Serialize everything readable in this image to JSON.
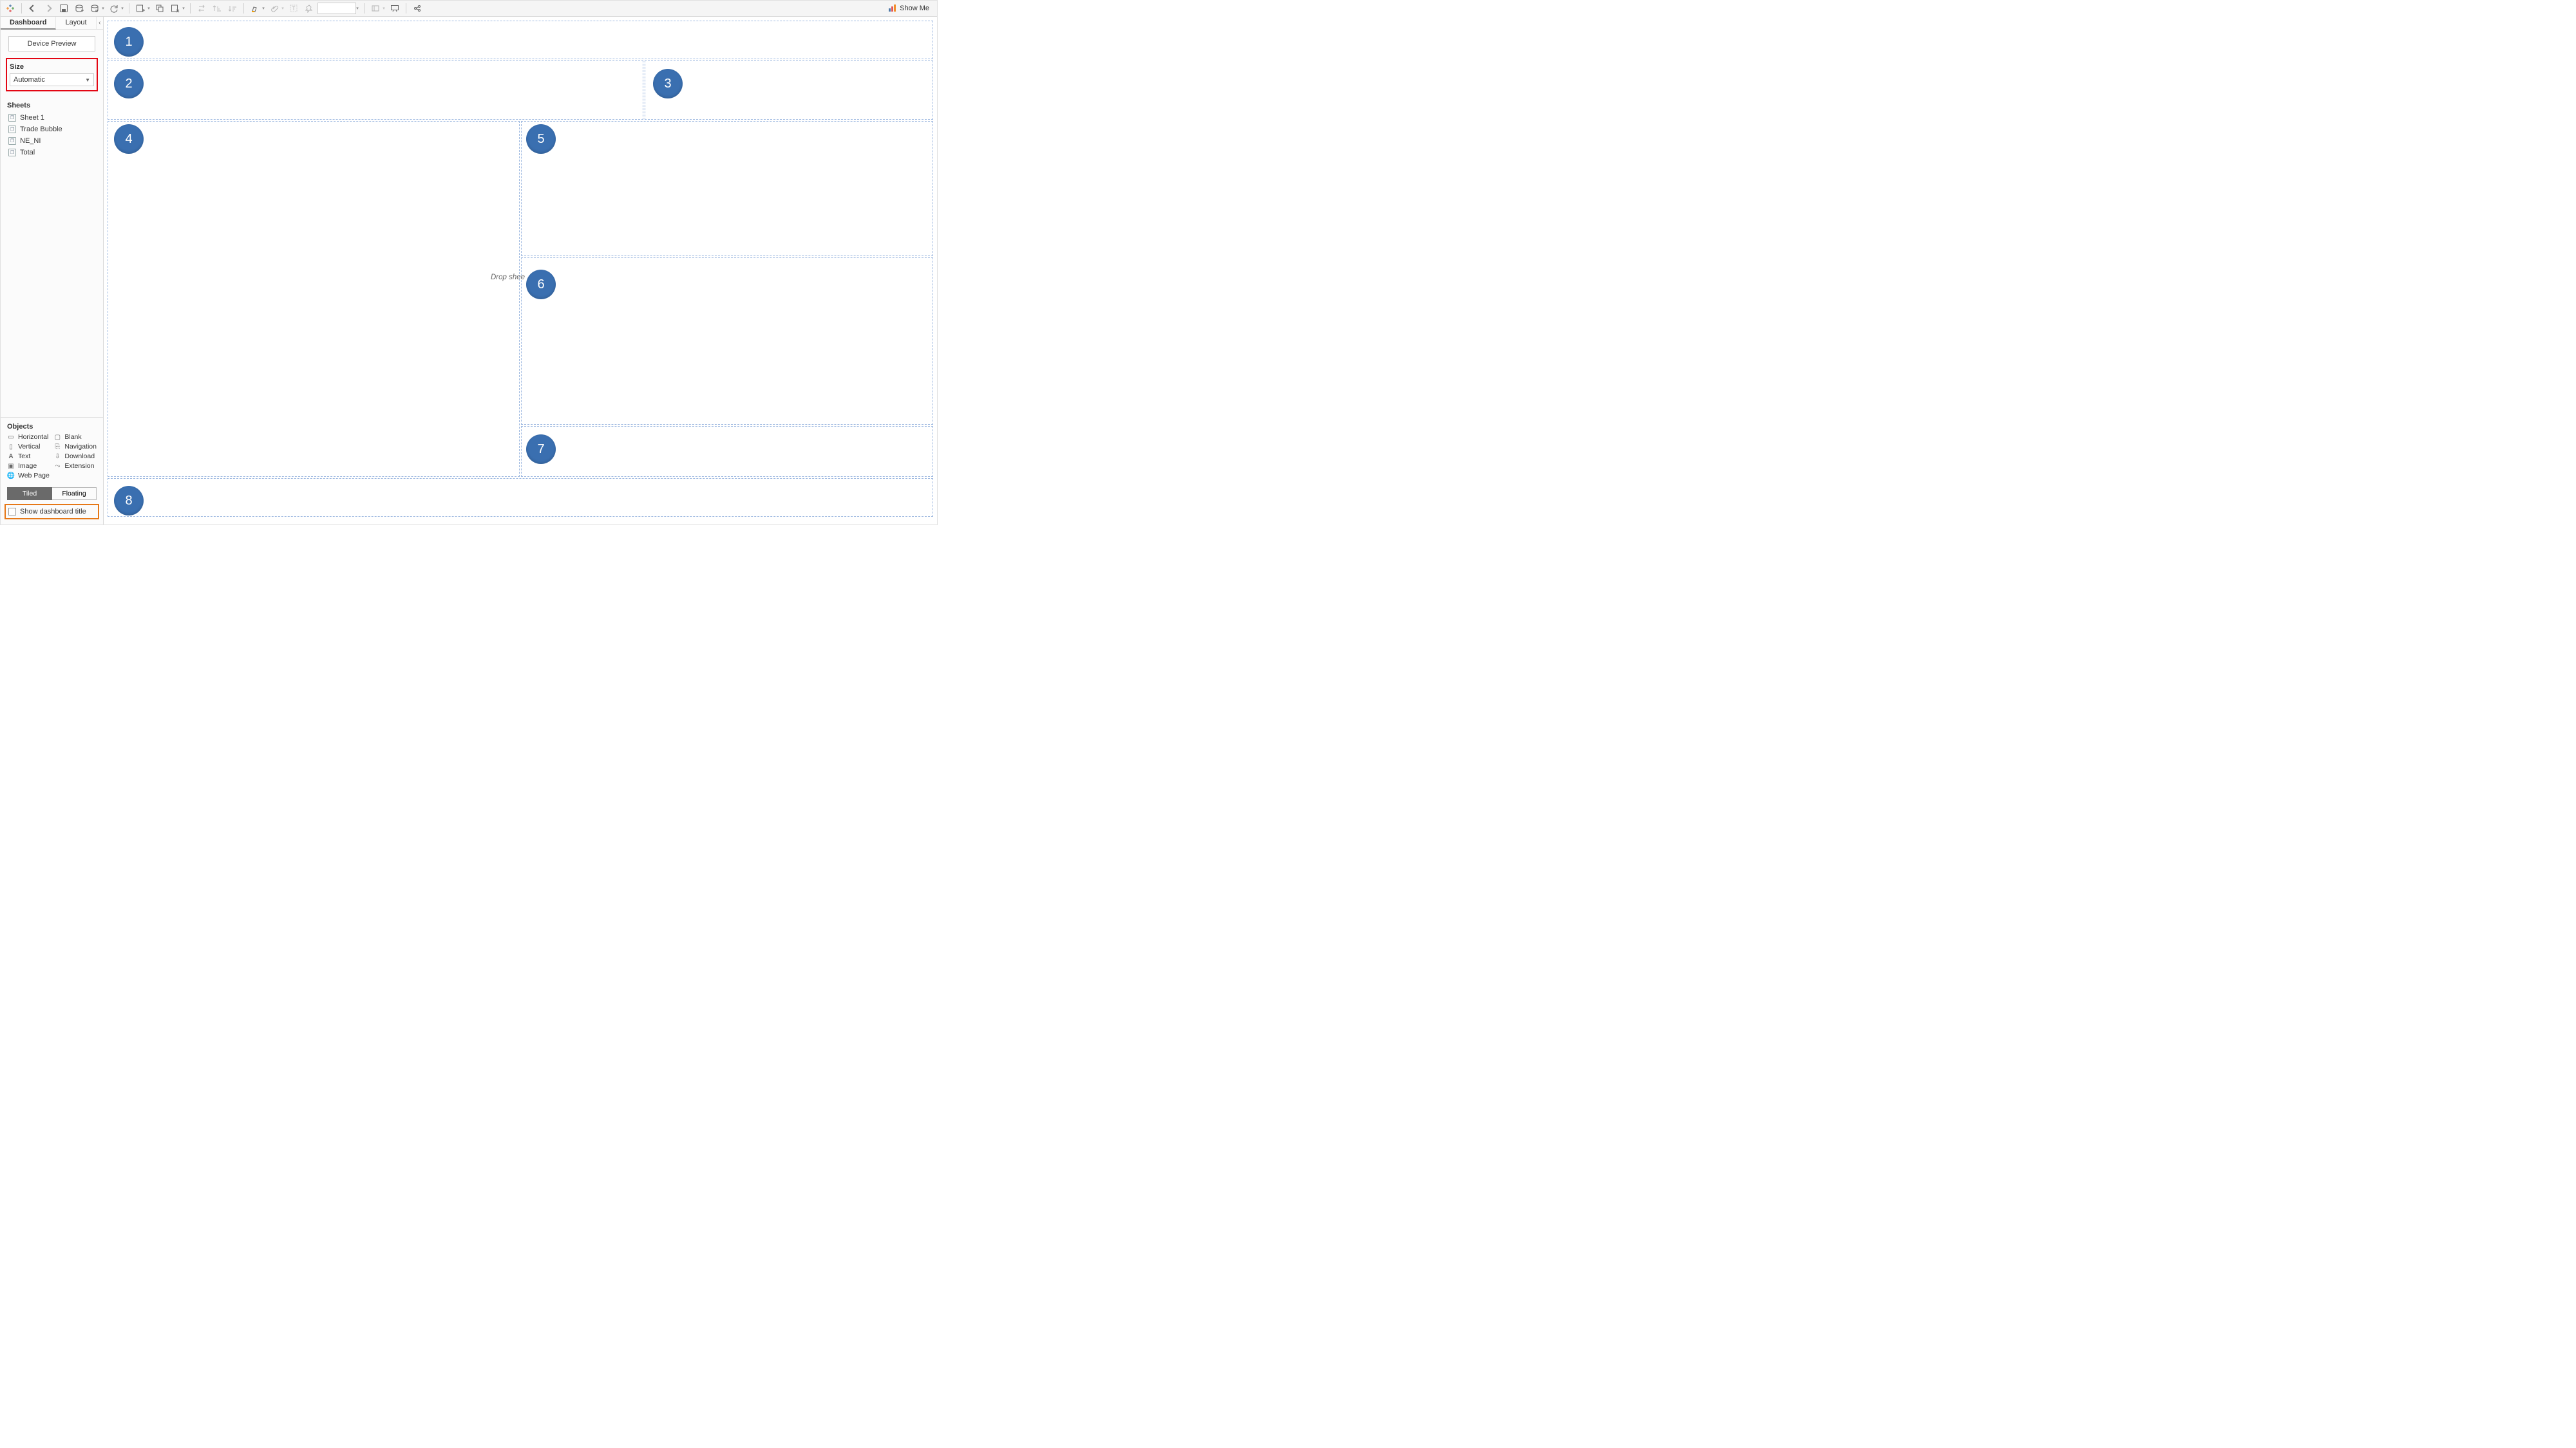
{
  "toolbar": {
    "show_me": "Show Me"
  },
  "sidebar": {
    "tabs": {
      "dashboard": "Dashboard",
      "layout": "Layout"
    },
    "device_preview": "Device Preview",
    "size_label": "Size",
    "size_value": "Automatic",
    "sheets_label": "Sheets",
    "sheets": [
      "Sheet 1",
      "Trade Bubble",
      "NE_NI",
      "Total"
    ],
    "objects_label": "Objects",
    "objects": {
      "horizontal": "Horizontal",
      "blank": "Blank",
      "vertical": "Vertical",
      "navigation": "Navigation",
      "text": "Text",
      "download": "Download",
      "image": "Image",
      "extension": "Extension",
      "webpage": "Web Page"
    },
    "tiled": "Tiled",
    "floating": "Floating",
    "show_title": "Show dashboard title"
  },
  "canvas": {
    "badges": [
      "1",
      "2",
      "3",
      "4",
      "5",
      "6",
      "7",
      "8"
    ],
    "drop_hint": "Drop shee"
  }
}
